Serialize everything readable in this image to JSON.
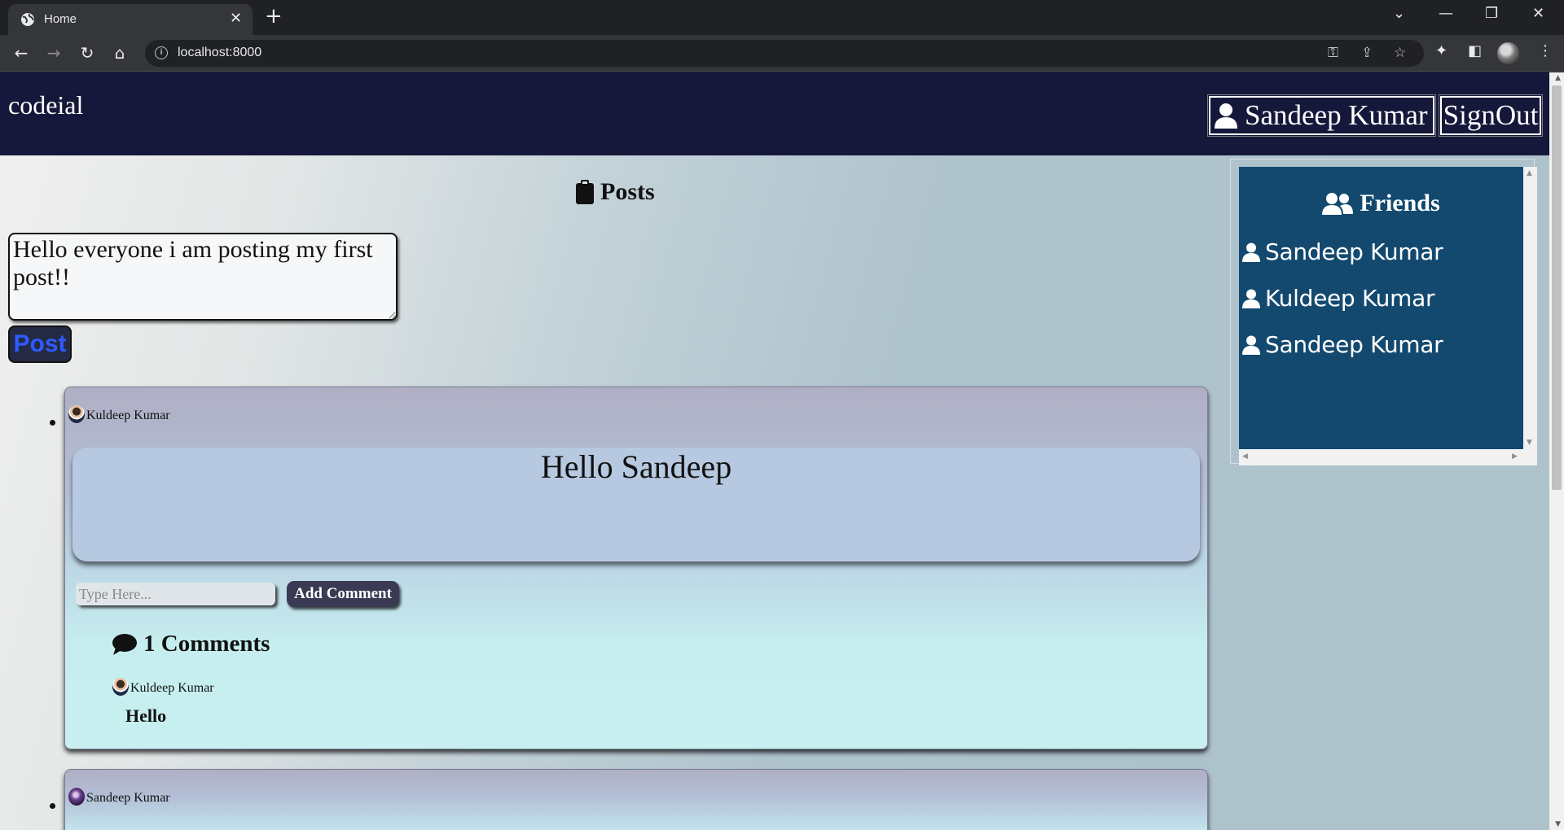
{
  "browser": {
    "tab_title": "Home",
    "url": "localhost:8000"
  },
  "header": {
    "brand": "codeial",
    "user_name": "Sandeep Kumar",
    "signout_label": "SignOut"
  },
  "posts_section": {
    "heading": "Posts",
    "textarea_value": "Hello everyone i am posting my first post!!",
    "post_button": "Post"
  },
  "posts": [
    {
      "author": "Kuldeep Kumar",
      "content": "Hello Sandeep",
      "comment_placeholder": "Type Here...",
      "add_comment_label": "Add Comment",
      "comments_heading": "1 Comments",
      "comments": [
        {
          "author": "Kuldeep Kumar",
          "text": "Hello"
        }
      ]
    },
    {
      "author": "Sandeep Kumar"
    }
  ],
  "friends": {
    "heading": "Friends",
    "items": [
      {
        "name": "Sandeep Kumar"
      },
      {
        "name": "Kuldeep Kumar"
      },
      {
        "name": "Sandeep Kumar"
      }
    ]
  },
  "icons": {
    "favicon": "globe-icon",
    "posts": "clipboard-icon",
    "comments": "comment-bubble-icon",
    "friends": "users-icon",
    "user": "user-icon"
  },
  "colors": {
    "header_bg": "#15183a",
    "friends_bg": "#13496f",
    "post_button_text": "#2e5bff"
  }
}
